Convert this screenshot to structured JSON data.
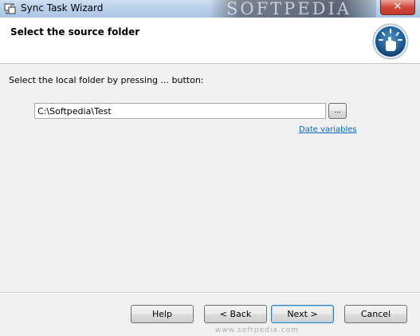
{
  "window": {
    "title": "Sync Task Wizard",
    "close_glyph": "✕",
    "watermark": "SOFTPEDIA"
  },
  "header": {
    "heading": "Select the source folder",
    "icon": "hand-pointer-sun-icon"
  },
  "body": {
    "instruction": "Select the local folder by pressing ... button:",
    "folder_value": "C:\\Softpedia\\Test",
    "browse_label": "...",
    "date_variables_link": "Date variables"
  },
  "footer": {
    "help_label": "Help",
    "back_label": "< Back",
    "next_label": "Next >",
    "cancel_label": "Cancel",
    "watermark": "www.softpedia.com"
  },
  "colors": {
    "link": "#0066cc",
    "accent": "#1e5f96",
    "close": "#c0392b"
  }
}
